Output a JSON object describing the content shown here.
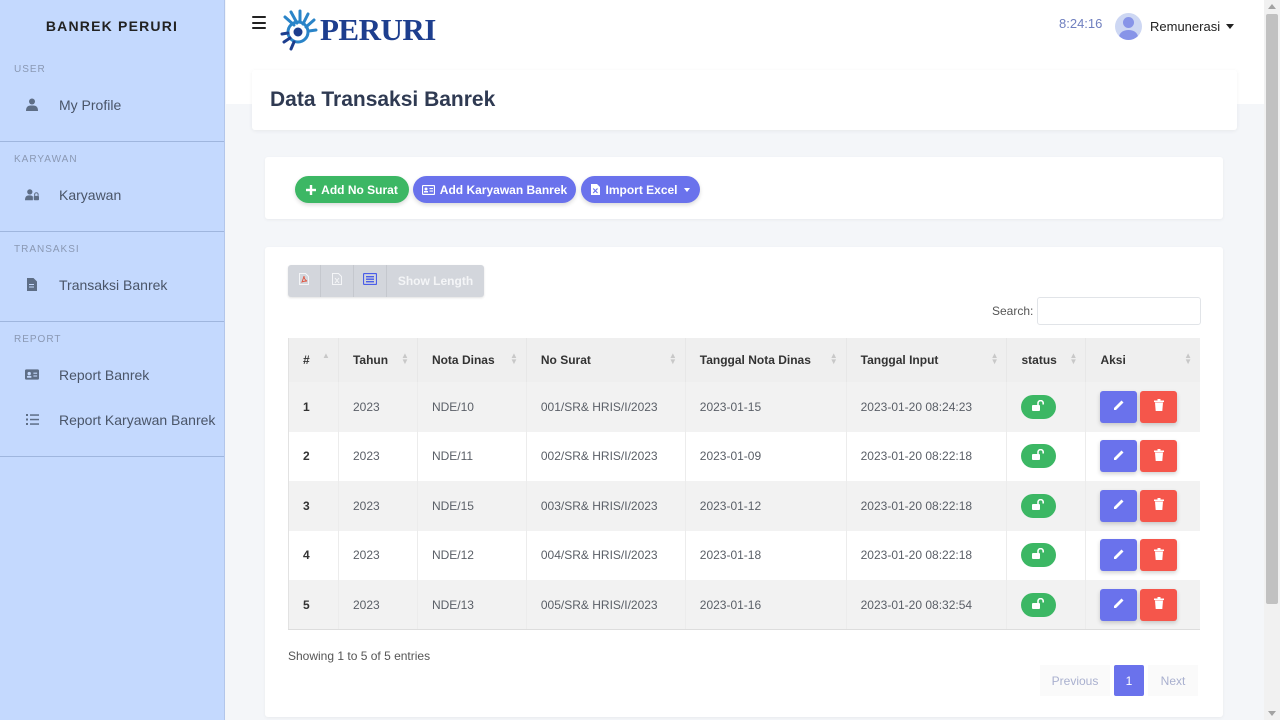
{
  "sidebar": {
    "brand": "BANREK PERURI",
    "sections": [
      {
        "heading": "USER",
        "items": [
          {
            "label": "My Profile",
            "icon": "user-icon"
          }
        ]
      },
      {
        "heading": "KARYAWAN",
        "items": [
          {
            "label": "Karyawan",
            "icon": "user-lock-icon"
          }
        ]
      },
      {
        "heading": "TRANSAKSI",
        "items": [
          {
            "label": "Transaksi Banrek",
            "icon": "file-invoice-icon"
          }
        ]
      },
      {
        "heading": "REPORT",
        "items": [
          {
            "label": "Report Banrek",
            "icon": "id-card-icon"
          },
          {
            "label": "Report Karyawan Banrek",
            "icon": "list-icon"
          }
        ]
      }
    ]
  },
  "topbar": {
    "logo_text": "PERURI",
    "clock": "8:24:16",
    "user_name": "Remunerasi"
  },
  "page": {
    "title": "Data Transaksi Banrek"
  },
  "actions": {
    "add_no_surat": "Add No Surat",
    "add_karyawan_banrek": "Add Karyawan Banrek",
    "import_excel": "Import Excel"
  },
  "datatable": {
    "buttons": {
      "show_length": "Show Length"
    },
    "search_label": "Search:",
    "search_value": "",
    "columns": [
      "#",
      "Tahun",
      "Nota Dinas",
      "No Surat",
      "Tanggal Nota Dinas",
      "Tanggal Input",
      "status",
      "Aksi"
    ],
    "rows": [
      {
        "no": "1",
        "tahun": "2023",
        "nota_dinas": "NDE/10",
        "no_surat": "001/SR& HRIS/I/2023",
        "tanggal_nota_dinas": "2023-01-15",
        "tanggal_input": "2023-01-20 08:24:23"
      },
      {
        "no": "2",
        "tahun": "2023",
        "nota_dinas": "NDE/11",
        "no_surat": "002/SR& HRIS/I/2023",
        "tanggal_nota_dinas": "2023-01-09",
        "tanggal_input": "2023-01-20 08:22:18"
      },
      {
        "no": "3",
        "tahun": "2023",
        "nota_dinas": "NDE/15",
        "no_surat": "003/SR& HRIS/I/2023",
        "tanggal_nota_dinas": "2023-01-12",
        "tanggal_input": "2023-01-20 08:22:18"
      },
      {
        "no": "4",
        "tahun": "2023",
        "nota_dinas": "NDE/12",
        "no_surat": "004/SR& HRIS/I/2023",
        "tanggal_nota_dinas": "2023-01-18",
        "tanggal_input": "2023-01-20 08:22:18"
      },
      {
        "no": "5",
        "tahun": "2023",
        "nota_dinas": "NDE/13",
        "no_surat": "005/SR& HRIS/I/2023",
        "tanggal_nota_dinas": "2023-01-16",
        "tanggal_input": "2023-01-20 08:32:54"
      }
    ],
    "info": "Showing 1 to 5 of 5 entries",
    "pagination": {
      "previous": "Previous",
      "current": "1",
      "next": "Next"
    }
  },
  "colors": {
    "sidebar_bg": "#c4d9fe",
    "primary": "#6a72ec",
    "success": "#3cb764",
    "danger": "#f5564b"
  }
}
